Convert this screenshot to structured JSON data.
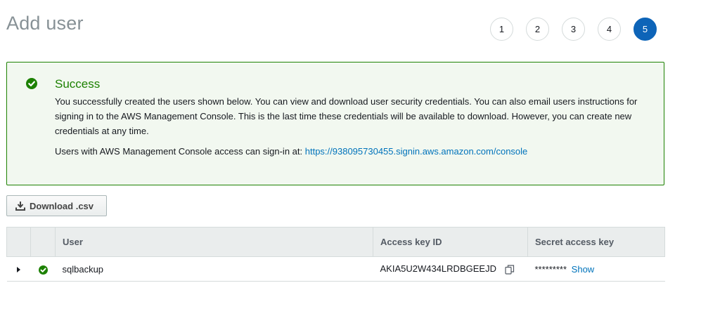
{
  "page": {
    "title": "Add user"
  },
  "steps": [
    {
      "label": "1",
      "active": false
    },
    {
      "label": "2",
      "active": false
    },
    {
      "label": "3",
      "active": false
    },
    {
      "label": "4",
      "active": false
    },
    {
      "label": "5",
      "active": true
    }
  ],
  "success": {
    "title": "Success",
    "message": "You successfully created the users shown below. You can view and download user security credentials. You can also email users instructions for signing in to the AWS Management Console. This is the last time these credentials will be available to download. However, you can create new credentials at any time.",
    "signin_prefix": "Users with AWS Management Console access can sign-in at: ",
    "signin_url": "https://938095730455.signin.aws.amazon.com/console",
    "icon": "check-circle-icon"
  },
  "toolbar": {
    "download_label": "Download .csv",
    "download_icon": "download-icon"
  },
  "table": {
    "headers": {
      "user": "User",
      "access_key_id": "Access key ID",
      "secret_access_key": "Secret access key"
    },
    "rows": [
      {
        "user": "sqlbackup",
        "access_key_id": "AKIA5U2W434LRDBGEEJD",
        "secret_masked": "*********",
        "show_label": "Show"
      }
    ]
  },
  "colors": {
    "success_green": "#1d8102",
    "success_bg": "#f2f8f0",
    "link_blue": "#0073bb",
    "active_step": "#0d64b8",
    "title_gray": "#879196"
  }
}
